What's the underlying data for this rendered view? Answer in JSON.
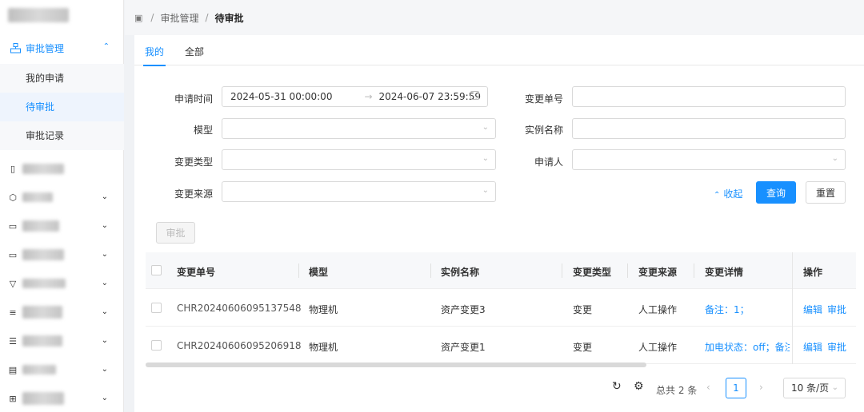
{
  "sidebar": {
    "menu_open": {
      "label": "审批管理",
      "icon": "approval-icon"
    },
    "sub_items": [
      "我的申请",
      "待审批",
      "审批记录"
    ],
    "active_sub": "待审批",
    "collapsed_rows": 9
  },
  "breadcrumb": {
    "items": [
      "审批管理",
      "待审批"
    ],
    "separator": "/"
  },
  "tabs": [
    "我的",
    "全部"
  ],
  "form": {
    "apply_time_label": "申请时间",
    "date_start": "2024-05-31 00:00:00",
    "date_end": "2024-06-07 23:59:59",
    "change_no_label": "变更单号",
    "model_label": "模型",
    "instance_label": "实例名称",
    "change_type_label": "变更类型",
    "applicant_label": "申请人",
    "change_source_label": "变更来源",
    "collapse_label": "收起",
    "query_label": "查询",
    "reset_label": "重置"
  },
  "approve_button": "审批",
  "table": {
    "columns": [
      "变更单号",
      "模型",
      "实例名称",
      "变更类型",
      "变更来源",
      "变更详情",
      "操作"
    ],
    "rows": [
      {
        "no": "CHR20240606095137548",
        "model": "物理机",
        "instance": "资产变更3",
        "type": "变更",
        "source": "人工操作",
        "detail": "备注：1；",
        "edit": "编辑",
        "approve": "审批"
      },
      {
        "no": "CHR20240606095206918",
        "model": "物理机",
        "instance": "资产变更1",
        "type": "变更",
        "source": "人工操作",
        "detail": "加电状态：off；备注：",
        "edit": "编辑",
        "approve": "审批"
      }
    ]
  },
  "pagination": {
    "total": "总共 2 条",
    "current": "1",
    "page_size": "10 条/页"
  },
  "colors": {
    "accent": "#1890ff"
  }
}
